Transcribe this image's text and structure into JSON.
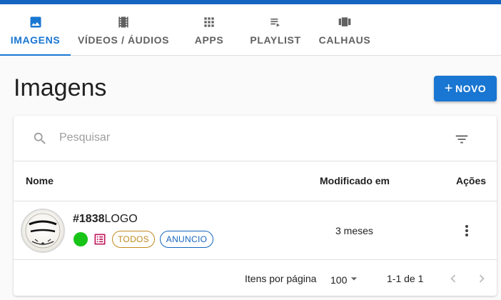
{
  "tabs": [
    {
      "label": "IMAGENS",
      "icon": "image-icon",
      "active": true
    },
    {
      "label": "VÍDEOS / ÁUDIOS",
      "icon": "film-icon",
      "active": false
    },
    {
      "label": "APPS",
      "icon": "apps-grid-icon",
      "active": false
    },
    {
      "label": "PLAYLIST",
      "icon": "playlist-play-icon",
      "active": false
    },
    {
      "label": "CALHAUS",
      "icon": "view-carousel-icon",
      "active": false
    }
  ],
  "page": {
    "title": "Imagens",
    "new_button": "NOVO"
  },
  "search": {
    "placeholder": "Pesquisar",
    "value": ""
  },
  "table": {
    "headers": {
      "name": "Nome",
      "modified": "Modificado em",
      "actions": "Ações"
    },
    "rows": [
      {
        "id": "#1838",
        "name": "LOGO",
        "status": "active",
        "tags": [
          "TODOS",
          "ANUNCIO"
        ],
        "modified": "3 meses"
      }
    ]
  },
  "pagination": {
    "rows_per_page_label": "Itens por página",
    "rows_per_page": "100",
    "range": "1-1 de 1"
  },
  "colors": {
    "primary": "#1976d2",
    "status_active": "#19c419",
    "chip_todos": "#c0891f",
    "chip_anuncio": "#1565c0",
    "list_icon": "#c2185b"
  }
}
